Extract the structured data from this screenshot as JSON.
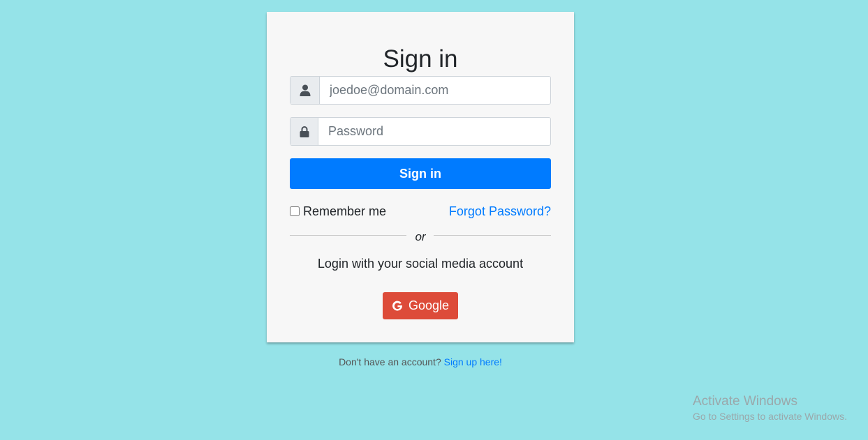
{
  "login": {
    "title": "Sign in",
    "email_placeholder": "joedoe@domain.com",
    "password_placeholder": "Password",
    "signin_button": "Sign in",
    "remember_label": "Remember me",
    "forgot_link": "Forgot Password?",
    "or_text": "or",
    "social_text": "Login with your social media account",
    "google_button": "Google"
  },
  "footer": {
    "text": "Don't have an account?",
    "signup_link": "Sign up here!"
  },
  "watermark": {
    "line1": "Activate Windows",
    "line2": "Go to Settings to activate Windows."
  },
  "colors": {
    "background": "#95e3e8",
    "primary": "#007bff",
    "google": "#dd4b39",
    "card": "#f7f7f7"
  },
  "icons": {
    "email": "user-icon",
    "password": "lock-icon",
    "google": "google-g-icon"
  }
}
